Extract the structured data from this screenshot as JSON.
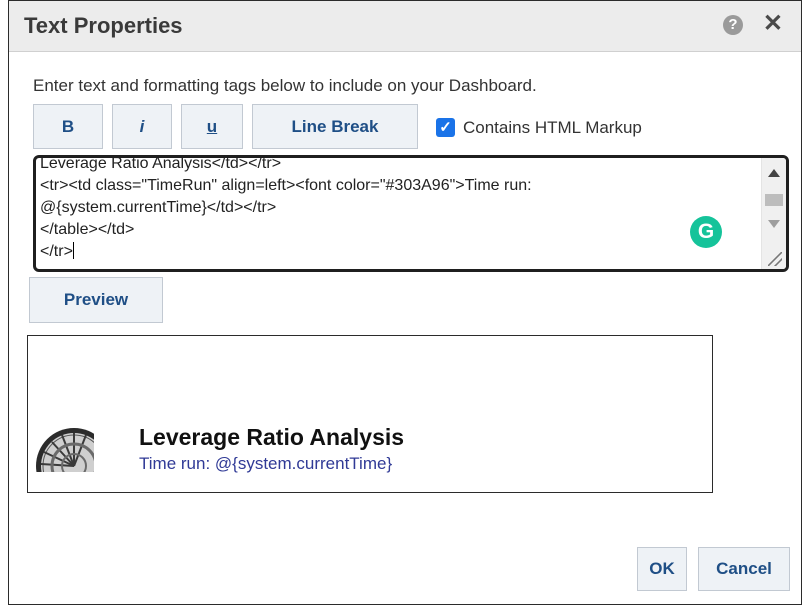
{
  "dialog": {
    "title": "Text Properties",
    "help_glyph": "?",
    "close_glyph": "✕"
  },
  "instruction": "Enter text and formatting tags below to include on your Dashboard.",
  "toolbar": {
    "bold_label": "B",
    "italic_label": "i",
    "underline_label": "u",
    "line_break_label": "Line Break"
  },
  "html_markup_checkbox": {
    "checked": true,
    "glyph": "✓",
    "label": "Contains HTML Markup"
  },
  "editor": {
    "lines": [
      "Leverage Ratio Analysis</td></tr>",
      "<tr><td class=\"TimeRun\" align=left><font color=\"#303A96\">Time run:",
      "@{system.currentTime}</td></tr>",
      "</table></td>",
      "</tr>"
    ],
    "grammarly_glyph": "G"
  },
  "preview_button_label": "Preview",
  "preview": {
    "title": "Leverage Ratio Analysis",
    "time_run": "Time run: @{system.currentTime}",
    "time_color": "#303A96"
  },
  "footer": {
    "ok_label": "OK",
    "cancel_label": "Cancel"
  },
  "colors": {
    "accent": "#1a73e8",
    "button_text": "#1f4f86",
    "grammarly": "#15c39a"
  }
}
